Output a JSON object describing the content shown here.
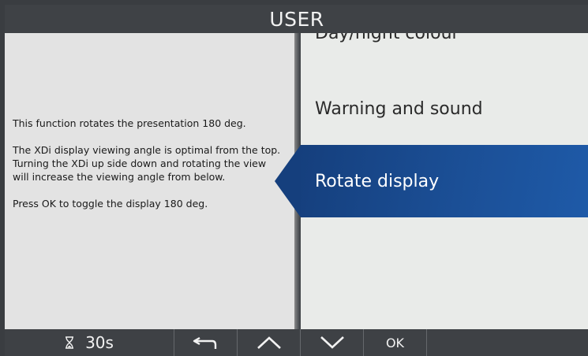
{
  "header": {
    "title": "USER"
  },
  "info": {
    "paragraphs": [
      "This function rotates the presentation 180 deg.",
      "The XDi display viewing angle is optimal from the top. Turning the XDi up side down and rotating the view will increase the viewing angle from below.",
      "Press OK to toggle the display 180 deg."
    ]
  },
  "menu": {
    "items": [
      {
        "label": "Day/night colour",
        "state": "partially-visible"
      },
      {
        "label": "Warning and sound",
        "state": "normal"
      },
      {
        "label": "Rotate display",
        "state": "selected"
      }
    ]
  },
  "footer": {
    "timer": "30s",
    "timer_icon": "hourglass-icon",
    "back_icon": "back-arrow-icon",
    "up_icon": "chevron-up-icon",
    "down_icon": "chevron-down-icon",
    "ok_label": "OK"
  },
  "colors": {
    "selected_bg": "#1b4f96",
    "menu_bg": "#e9ebe9",
    "info_bg": "#e3e3e3",
    "bar_bg": "#3e4145"
  }
}
